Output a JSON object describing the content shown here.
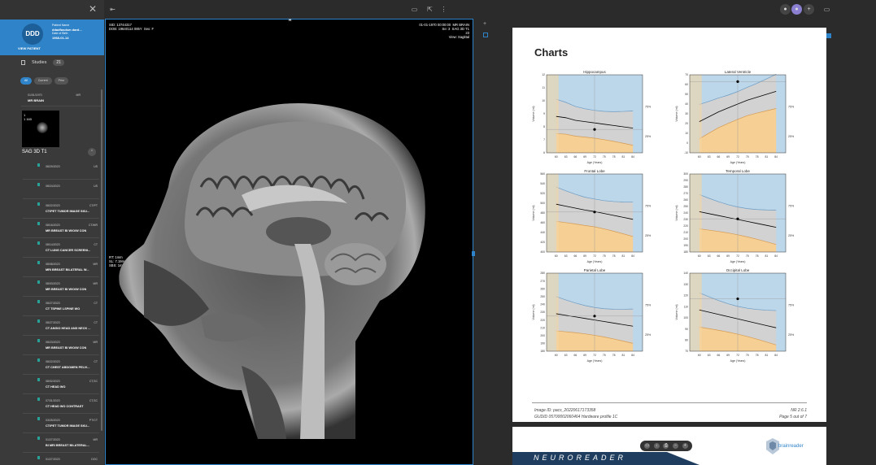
{
  "sidebar": {
    "close_icon": "close-icon",
    "avatar_initials": "DDD",
    "patient_name_label": "Patient Name",
    "patient_name": "ddadfasdsm dard...",
    "dob_label": "Date of Birth",
    "dob": "1968-01-14",
    "view_patient": "VIEW PATIENT",
    "studies_label": "Studies",
    "studies_count": "21",
    "filters": [
      "All",
      "Current",
      "Prior"
    ],
    "current_study": {
      "date": "01/01/1970",
      "modality": "MR",
      "title": "MR BRAIN"
    },
    "thumbnail_label": "1\n1 160",
    "series_name": "SAG 3D T1",
    "studies": [
      {
        "date": "08/29/2023",
        "modality": "US",
        "title": ""
      },
      {
        "date": "08/24/2023",
        "modality": "US",
        "title": ""
      },
      {
        "date": "08/22/2023",
        "modality": "CT/PT",
        "title": "CT/PET TUMOR IMAGE SKU..."
      },
      {
        "date": "08/16/2023",
        "modality": "CT/MR",
        "title": "MR BREAST BI W/O/W CON"
      },
      {
        "date": "08/14/2023",
        "modality": "CT",
        "title": "CT LUNG CANCER SCREENI..."
      },
      {
        "date": "08/08/2023",
        "modality": "MR",
        "title": "MRI BREAST BILATERAL W..."
      },
      {
        "date": "08/03/2023",
        "modality": "MR",
        "title": "MR BREAST BI W/O/W CON"
      },
      {
        "date": "08/27/2023",
        "modality": "CT",
        "title": "CT TSPINE LSPINE WO"
      },
      {
        "date": "08/27/2023",
        "modality": "CT",
        "title": "CT ANGIO HEAD AND NECK ..."
      },
      {
        "date": "08/23/2023",
        "modality": "MR",
        "title": "MR BREAST BI W/O/W CON"
      },
      {
        "date": "08/22/2023",
        "modality": "CT",
        "title": "CT CHEST ABDOMEN PELVI..."
      },
      {
        "date": "08/02/2023",
        "modality": "CT,SC",
        "title": "CT HEAD WO"
      },
      {
        "date": "07/31/2023",
        "modality": "CT,SC",
        "title": "CT HEAD WO CONTRAST"
      },
      {
        "date": "03/25/2023",
        "modality": "PT/CT",
        "title": "CT/PET TUMOR IMAGE SKU..."
      },
      {
        "date": "01/27/2023",
        "modality": "MR",
        "title": "BI MRI BREAST BILATERAL..."
      },
      {
        "date": "01/27/2023",
        "modality": "DOC",
        "title": ""
      }
    ]
  },
  "viewer": {
    "top_left": "SID: 13744317\nDOB: 19640114 085Y  Sex: F",
    "top_right": "01-01-1970 00:00:00  MR BRAIN\nSe: 3  SAG 3D T1\n23\nView: Sagittal",
    "mid_left": "RT: 1mm\nSL: 7.19mm\nSBS: 1mm",
    "top_marker": "H"
  },
  "report": {
    "title": "Charts",
    "footer_left_1": "Image ID: pacs_20220617173358",
    "footer_left_2": "GUDID 05700002060464 Hardware profile 1C",
    "footer_right_1": "NR 2.6.1",
    "footer_right_2": "Page 5 out of 7",
    "brand": "NEUROREADER",
    "logo_text": "brainreader"
  },
  "chart_data": [
    {
      "type": "line",
      "title": "Hippocampus",
      "xlabel": "Age (Years)",
      "ylabel": "Volume (ml)",
      "x": [
        60,
        63,
        66,
        69,
        72,
        75,
        78,
        81,
        84
      ],
      "ylim": [
        6,
        12
      ],
      "yticks": [
        6,
        7,
        8,
        9,
        10,
        11,
        12
      ],
      "series": [
        {
          "values": [
            8.8,
            8.7,
            8.5,
            8.4,
            8.3,
            8.2,
            8.1,
            8.0,
            7.9
          ]
        }
      ],
      "patient": {
        "x": 72,
        "y": 7.8
      },
      "percentiles": [
        "75%",
        "25%"
      ]
    },
    {
      "type": "line",
      "title": "Lateral Ventricle",
      "xlabel": "Age (Years)",
      "ylabel": "Volume (ml)",
      "x": [
        60,
        63,
        66,
        69,
        72,
        75,
        78,
        81,
        84
      ],
      "ylim": [
        -10,
        70
      ],
      "yticks": [
        -10,
        0,
        10,
        20,
        30,
        40,
        50,
        60,
        70
      ],
      "series": [
        {
          "values": [
            22,
            27,
            32,
            36,
            40,
            44,
            47,
            50,
            53
          ]
        }
      ],
      "patient": {
        "x": 72,
        "y": 63
      },
      "percentiles": [
        "75%",
        "25%"
      ]
    },
    {
      "type": "line",
      "title": "Frontal Lobe",
      "xlabel": "Age (Years)",
      "ylabel": "Volume (ml)",
      "x": [
        60,
        63,
        66,
        69,
        72,
        75,
        78,
        81,
        84
      ],
      "ylim": [
        400,
        560
      ],
      "yticks": [
        400,
        420,
        440,
        460,
        480,
        500,
        520,
        540,
        560
      ],
      "series": [
        {
          "values": [
            498,
            494,
            490,
            486,
            483,
            479,
            475,
            471,
            467
          ]
        }
      ],
      "patient": {
        "x": 72,
        "y": 482
      },
      "percentiles": [
        "75%",
        "25%"
      ]
    },
    {
      "type": "line",
      "title": "Temporal Lobe",
      "xlabel": "Age (Years)",
      "ylabel": "Volume (ml)",
      "x": [
        60,
        63,
        66,
        69,
        72,
        75,
        78,
        81,
        84
      ],
      "ylim": [
        180,
        300
      ],
      "yticks": [
        180,
        190,
        200,
        210,
        220,
        230,
        240,
        250,
        260,
        270,
        280,
        290,
        300
      ],
      "series": [
        {
          "values": [
            242,
            239,
            236,
            233,
            230,
            227,
            224,
            221,
            218
          ]
        }
      ],
      "patient": {
        "x": 72,
        "y": 231
      },
      "percentiles": [
        "75%",
        "25%"
      ]
    },
    {
      "type": "line",
      "title": "Parietal Lobe",
      "xlabel": "Age (Years)",
      "ylabel": "Volume (ml)",
      "x": [
        60,
        63,
        66,
        69,
        72,
        75,
        78,
        81,
        84
      ],
      "ylim": [
        180,
        280
      ],
      "yticks": [
        180,
        190,
        200,
        210,
        220,
        230,
        240,
        250,
        260,
        270,
        280
      ],
      "series": [
        {
          "values": [
            228,
            226,
            224,
            222,
            220,
            218,
            216,
            214,
            212
          ]
        }
      ],
      "patient": {
        "x": 72,
        "y": 225
      },
      "percentiles": [
        "75%",
        "25%"
      ]
    },
    {
      "type": "line",
      "title": "Occipital Lobe",
      "xlabel": "Age (Years)",
      "ylabel": "Volume (ml)",
      "x": [
        60,
        63,
        66,
        69,
        72,
        75,
        78,
        81,
        84
      ],
      "ylim": [
        70,
        140
      ],
      "yticks": [
        70,
        80,
        90,
        100,
        110,
        120,
        130,
        140
      ],
      "series": [
        {
          "values": [
            107,
            105,
            103,
            101,
            99,
            97,
            95,
            93,
            91
          ]
        }
      ],
      "patient": {
        "x": 72,
        "y": 117
      },
      "percentiles": [
        "75%",
        "25%"
      ]
    }
  ]
}
